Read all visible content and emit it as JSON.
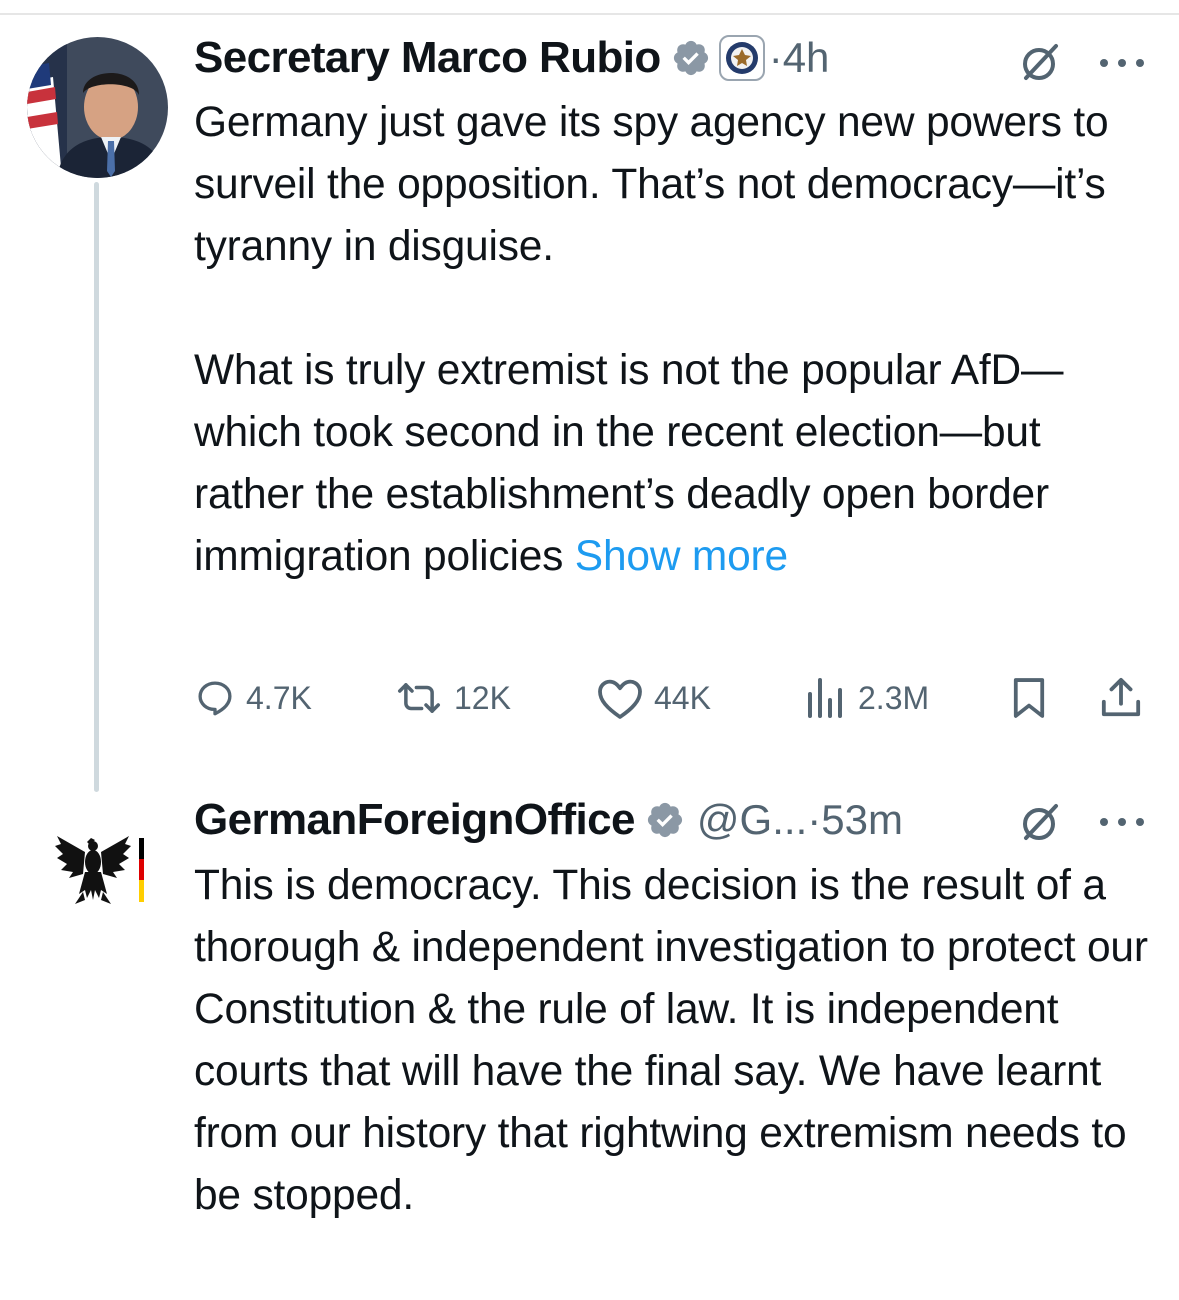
{
  "tweets": [
    {
      "name": "Secretary Marco Rubio",
      "time": "4h",
      "paragraphs": [
        "Germany just gave its spy agency new powers to surveil the opposition.  That’s not democracy—it’s tyranny in disguise.",
        "What is truly extremist is not the popular AfD—which took second in the recent election—but rather the establishment’s deadly open border immigration policies"
      ],
      "show_more": "Show more",
      "actions": {
        "replies": "4.7K",
        "reposts": "12K",
        "likes": "44K",
        "views": "2.3M"
      },
      "icons": {
        "verified": "verified-badge-icon",
        "affiliation": "state-department-seal-icon",
        "grok": "grok-icon",
        "more": "more-options-icon"
      }
    },
    {
      "name": "GermanForeignOffice",
      "handle": "@G...",
      "time": "53m",
      "paragraphs": [
        "This is democracy. This decision is the result of a thorough & independent investigation to protect our Constitution & the rule of law. It is independent courts that will have the final say. We have learnt from our history that rightwing extremism needs to be stopped."
      ],
      "icons": {
        "avatar": "federal-eagle-flag-logo",
        "verified": "verified-badge-icon",
        "grok": "grok-icon",
        "more": "more-options-icon"
      }
    }
  ],
  "colors": {
    "text": "#0f1419",
    "secondary": "#536471",
    "link": "#1d9bf0",
    "thread_line": "#cfd9de",
    "flag_black": "#000000",
    "flag_red": "#dd0000",
    "flag_gold": "#ffce00"
  }
}
